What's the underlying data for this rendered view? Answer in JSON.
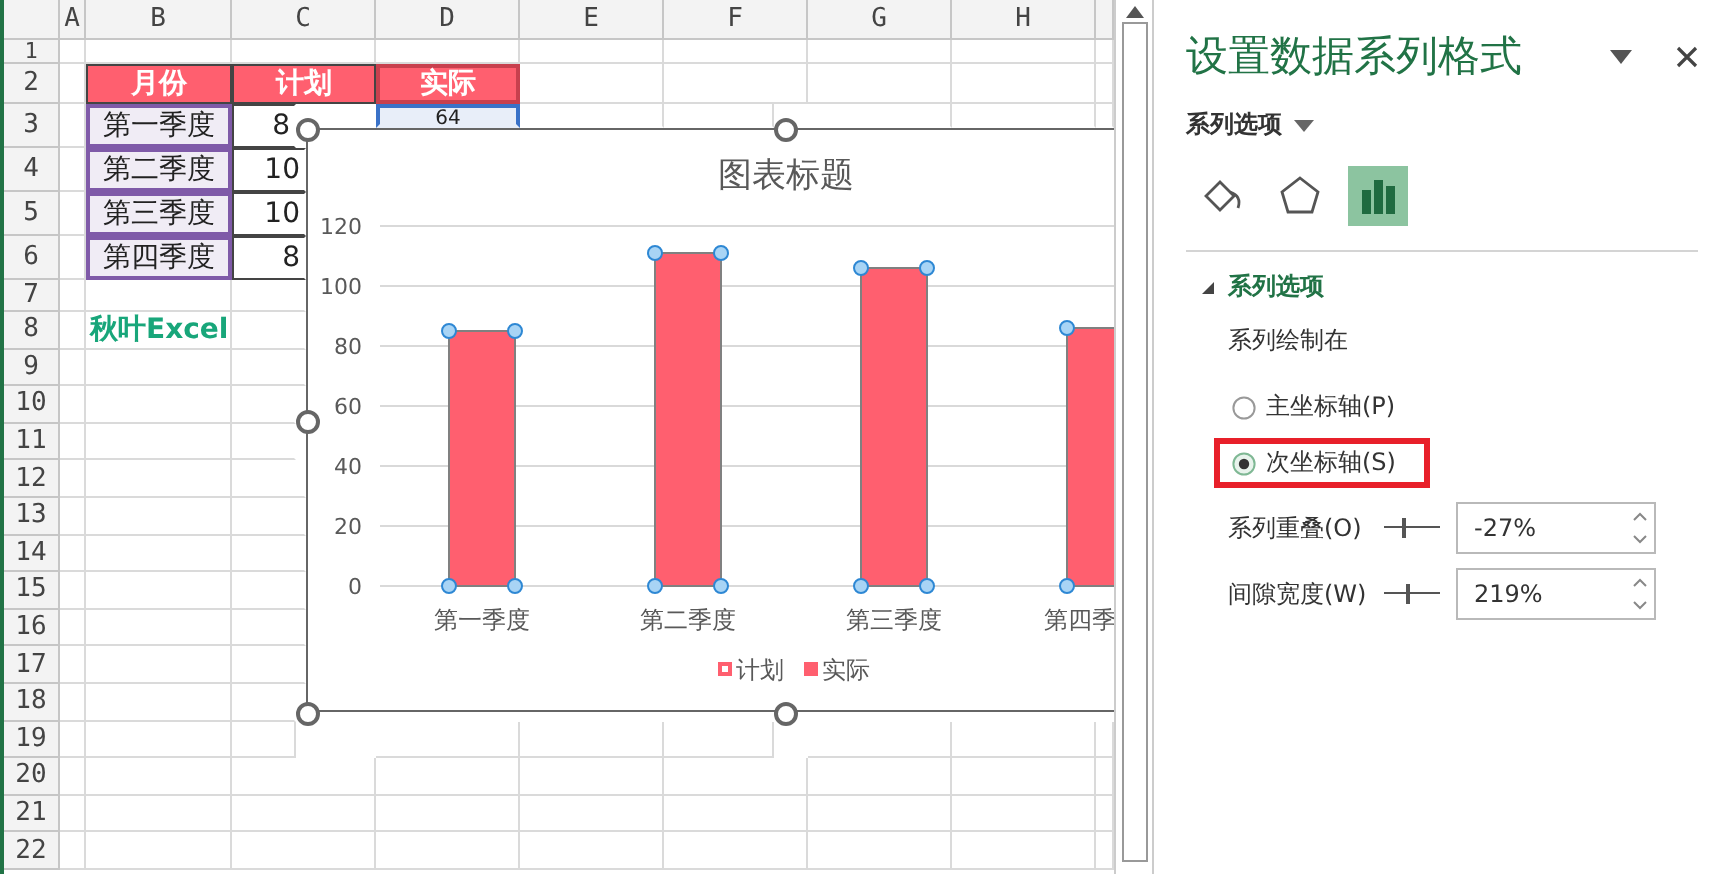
{
  "sheet": {
    "columns": [
      "A",
      "B",
      "C",
      "D",
      "E",
      "F",
      "G",
      "H",
      ""
    ],
    "rows": [
      "1",
      "2",
      "3",
      "4",
      "5",
      "6",
      "7",
      "8",
      "9",
      "10",
      "11",
      "12",
      "13",
      "14",
      "15",
      "16",
      "17",
      "18",
      "19",
      "20",
      "21",
      "22"
    ],
    "table": {
      "header": [
        {
          "text": "月份",
          "kind": "plain"
        },
        {
          "text": "计划",
          "kind": "plain"
        },
        {
          "text": "实际",
          "kind": "series_name"
        }
      ],
      "rows": [
        {
          "cells": [
            {
              "text": "第一季度",
              "kind": "categories"
            },
            {
              "text": "8",
              "kind": "plain"
            },
            {
              "text": "64",
              "kind": "values"
            }
          ]
        },
        {
          "cells": [
            {
              "text": "第二季度",
              "kind": "categories"
            },
            {
              "text": "10",
              "kind": "plain"
            }
          ]
        },
        {
          "cells": [
            {
              "text": "第三季度",
              "kind": "categories"
            },
            {
              "text": "10",
              "kind": "plain"
            }
          ]
        },
        {
          "cells": [
            {
              "text": "第四季度",
              "kind": "categories"
            },
            {
              "text": "8",
              "kind": "plain"
            }
          ]
        }
      ]
    },
    "note": "秋叶Excel"
  },
  "chart": {
    "chart_data": {
      "type": "bar",
      "title": "图表标题",
      "categories": [
        "第一季度",
        "第二季度",
        "第三季度",
        "第四季"
      ],
      "series": [
        {
          "name": "计划",
          "color": "#ff5f6f",
          "values": [
            null,
            null,
            null,
            null
          ]
        },
        {
          "name": "实际",
          "color": "#ff5f6f",
          "values": [
            85,
            111,
            106,
            86
          ]
        }
      ],
      "ylim": [
        0,
        120
      ],
      "yticks": [
        0,
        20,
        40,
        60,
        80,
        100,
        120
      ],
      "grid": true
    }
  },
  "panel": {
    "title": "设置数据系列格式",
    "options_menu": "系列选项",
    "tabs": [
      {
        "kind": "fill",
        "selected": false
      },
      {
        "kind": "effects",
        "selected": false
      },
      {
        "kind": "series",
        "selected": true
      }
    ],
    "section": {
      "title": "系列选项",
      "expanded": true,
      "plot_on_label": "系列绘制在",
      "radios": [
        {
          "label": "主坐标轴(P)",
          "selected": false,
          "highlighted": false
        },
        {
          "label": "次坐标轴(S)",
          "selected": true,
          "highlighted": true
        }
      ],
      "spinners": [
        {
          "label": "系列重叠(O)",
          "level": 0.365,
          "value": "-27%"
        },
        {
          "label": "间隙宽度(W)",
          "level": 0.44,
          "value": "219%"
        }
      ]
    }
  }
}
